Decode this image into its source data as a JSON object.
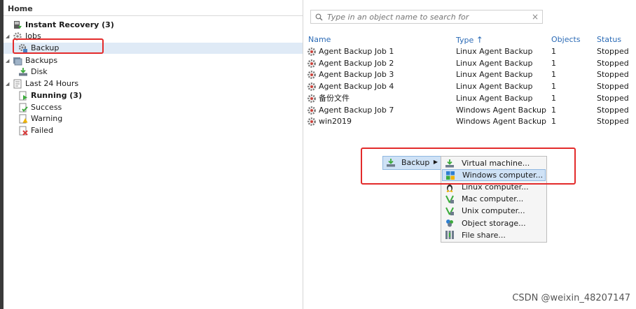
{
  "tree": {
    "header": "Home",
    "items": [
      {
        "label": "Instant Recovery (3)",
        "icon": "instant-recovery-icon",
        "bold": true
      },
      {
        "label": "Jobs",
        "icon": "jobs-icon",
        "bold": false
      },
      {
        "label": "Backup",
        "icon": "backup-job-icon",
        "bold": false
      },
      {
        "label": "Backups",
        "icon": "backups-icon",
        "bold": false
      },
      {
        "label": "Disk",
        "icon": "disk-icon",
        "bold": false
      },
      {
        "label": "Last 24 Hours",
        "icon": "history-icon",
        "bold": false
      },
      {
        "label": "Running (3)",
        "icon": "running-icon",
        "bold": true
      },
      {
        "label": "Success",
        "icon": "success-icon",
        "bold": false
      },
      {
        "label": "Warning",
        "icon": "warning-icon",
        "bold": false
      },
      {
        "label": "Failed",
        "icon": "failed-icon",
        "bold": false
      }
    ]
  },
  "search": {
    "placeholder": "Type in an object name to search for",
    "clear": "×"
  },
  "table": {
    "columns": [
      "Name",
      "Type",
      "Objects",
      "Status"
    ],
    "sort_indicator": "↑",
    "rows": [
      {
        "name": "Agent Backup Job 1",
        "type": "Linux Agent Backup",
        "objects": "1",
        "status": "Stopped"
      },
      {
        "name": "Agent Backup Job 2",
        "type": "Linux Agent Backup",
        "objects": "1",
        "status": "Stopped"
      },
      {
        "name": "Agent Backup Job 3",
        "type": "Linux Agent Backup",
        "objects": "1",
        "status": "Stopped"
      },
      {
        "name": "Agent Backup Job 4",
        "type": "Linux Agent Backup",
        "objects": "1",
        "status": "Stopped"
      },
      {
        "name": "备份文件",
        "type": "Linux Agent Backup",
        "objects": "1",
        "status": "Stopped"
      },
      {
        "name": "Agent Backup Job 7",
        "type": "Windows Agent Backup",
        "objects": "1",
        "status": "Stopped"
      },
      {
        "name": "win2019",
        "type": "Windows Agent Backup",
        "objects": "1",
        "status": "Stopped"
      }
    ]
  },
  "context_menu": {
    "parent": {
      "label": "Backup",
      "arrow": "▶"
    },
    "items": [
      {
        "label": "Virtual machine...",
        "icon": "vm-icon"
      },
      {
        "label": "Windows computer...",
        "icon": "windows-icon",
        "highlighted": true
      },
      {
        "label": "Linux computer...",
        "icon": "linux-icon"
      },
      {
        "label": "Mac computer...",
        "icon": "mac-icon"
      },
      {
        "label": "Unix computer...",
        "icon": "unix-icon"
      },
      {
        "label": "Object storage...",
        "icon": "object-storage-icon"
      },
      {
        "label": "File share...",
        "icon": "file-share-icon"
      }
    ]
  },
  "watermark": "CSDN @weixin_48207147",
  "colors": {
    "accent": "#2c6bb6",
    "selection": "#dfeaf6",
    "highlight": "#cfe2f6",
    "annotation": "#e32b2b"
  }
}
